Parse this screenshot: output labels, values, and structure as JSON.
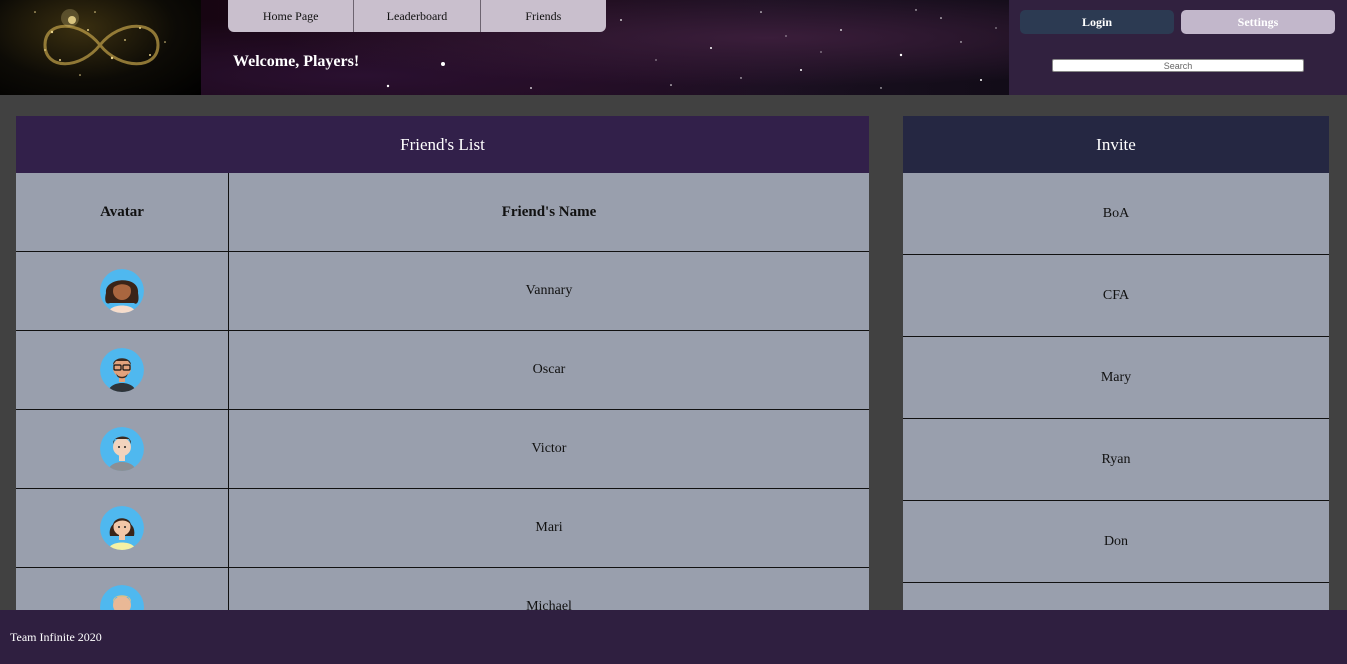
{
  "header": {
    "nav": [
      "Home Page",
      "Leaderboard",
      "Friends"
    ],
    "welcome": "Welcome, Players!",
    "login_label": "Login",
    "settings_label": "Settings",
    "search_placeholder": "Search"
  },
  "friends": {
    "title": "Friend's List",
    "columns": [
      "Avatar",
      "Friend's Name"
    ],
    "rows": [
      {
        "name": "Vannary",
        "avatar": "woman-curly-hair-avatar-icon"
      },
      {
        "name": "Oscar",
        "avatar": "man-glasses-avatar-icon"
      },
      {
        "name": "Victor",
        "avatar": "man-avatar-icon"
      },
      {
        "name": "Mari",
        "avatar": "woman-avatar-icon"
      },
      {
        "name": "Michael",
        "avatar": "man-blond-avatar-icon"
      }
    ]
  },
  "invite": {
    "title": "Invite",
    "items": [
      "BoA",
      "CFA",
      "Mary",
      "Ryan",
      "Don"
    ]
  },
  "footer": {
    "text": "Team Infinite 2020"
  },
  "colors": {
    "page_bg": "#414141",
    "header_panel": "#31213f",
    "friends_title_bg": "#32204a",
    "invite_title_bg": "#252742",
    "row_bg": "#999fad",
    "footer_bg": "#2f1f40",
    "avatar_circle": "#4fb8ef"
  }
}
